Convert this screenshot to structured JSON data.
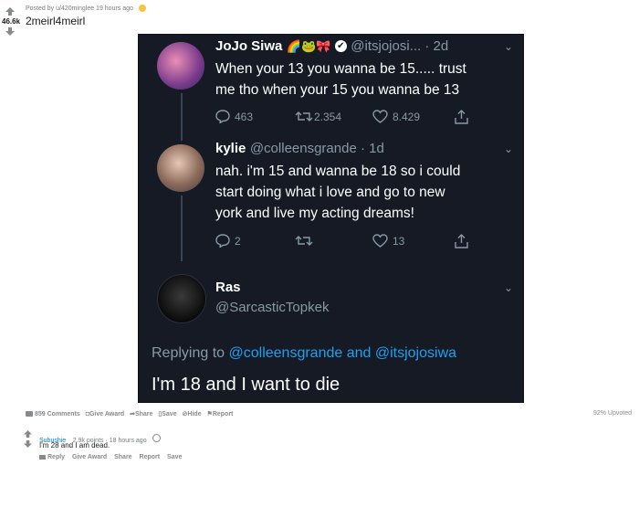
{
  "post": {
    "meta_text": "Posted by u/420minglee 19 hours ago",
    "score": "46.6k",
    "title": "2meirl4meirl"
  },
  "tweets": [
    {
      "name": "JoJo Siwa",
      "emoji": "🌈🐸🎀",
      "handle": "@itsjojosi... · 2d",
      "text_line1": "When your 13 you wanna be 15..... trust",
      "text_line2": "me tho when your 15 you wanna be 13",
      "replies": "463",
      "retweets": "2.354",
      "likes": "8.429"
    },
    {
      "name": "kylie",
      "handle": "@colleensgrande · 1d",
      "text_line1": "nah. i'm 15 and wanna be 18 so i could",
      "text_line2": "start doing what i love and go to new",
      "text_line3": "york and live my acting dreams!",
      "replies": "2",
      "retweets": "",
      "likes": "13"
    },
    {
      "name": "Ras",
      "handle": "@SarcasticTopkek",
      "replying_prefix": "Replying to ",
      "replying_user1": "@colleensgrande",
      "replying_and": " and ",
      "replying_user2": "@itsjojosiwa",
      "text": "I'm 18 and I want to die"
    }
  ],
  "footer": {
    "comments": "859 Comments",
    "give_award": "Give Award",
    "share": "Share",
    "save": "Save",
    "hide": "Hide",
    "report": "Report",
    "upvoted": "92% Upvoted"
  },
  "comment": {
    "author": "Subushie",
    "points": "2.9k points · 18 hours ago",
    "text": "I'm 28 and I am dead.",
    "reply": "Reply",
    "give_award": "Give Award",
    "share": "Share",
    "report": "Report",
    "save": "Save"
  },
  "colors": {
    "upvote": "#ff4500",
    "link": "#1da1f2",
    "tweet_bg": "#151a25"
  }
}
